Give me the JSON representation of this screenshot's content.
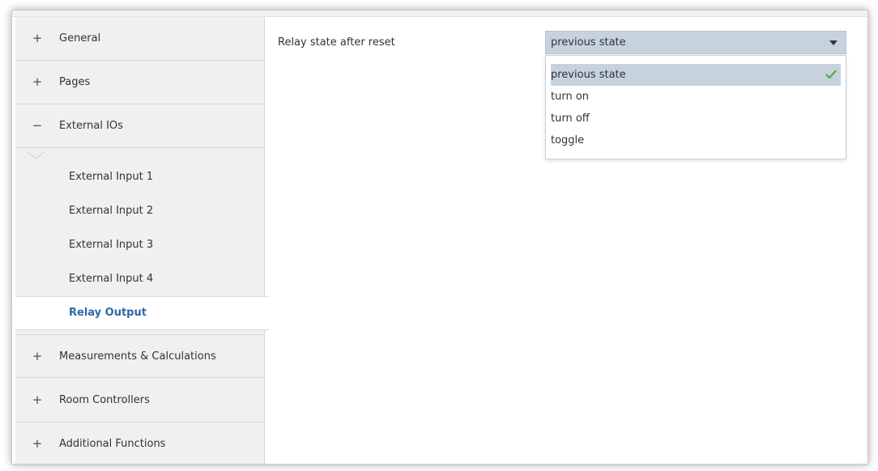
{
  "sidebar": {
    "groups_top": [
      {
        "sign": "+",
        "label": "General"
      },
      {
        "sign": "+",
        "label": "Pages"
      },
      {
        "sign": "−",
        "label": "External IOs"
      }
    ],
    "sub_items": [
      {
        "label": "External Input 1"
      },
      {
        "label": "External Input 2"
      },
      {
        "label": "External Input 3"
      },
      {
        "label": "External Input 4"
      },
      {
        "label": "Relay Output",
        "selected": true
      }
    ],
    "groups_bottom": [
      {
        "sign": "+",
        "label": "Measurements & Calculations"
      },
      {
        "sign": "+",
        "label": "Room Controllers"
      },
      {
        "sign": "+",
        "label": "Additional Functions"
      }
    ]
  },
  "main": {
    "parameter_label": "Relay state after reset",
    "select": {
      "value": "previous state",
      "options": [
        {
          "label": "previous state",
          "selected": true
        },
        {
          "label": "turn on"
        },
        {
          "label": "turn off"
        },
        {
          "label": "toggle"
        }
      ]
    }
  },
  "colors": {
    "accent": "#2e6aa7",
    "check": "#5aa63c",
    "select_bg": "#c6d3df"
  },
  "icons": {
    "expand": "plus-icon",
    "collapse": "minus-icon",
    "dropdown": "caret-down-icon",
    "selected": "check-icon"
  }
}
